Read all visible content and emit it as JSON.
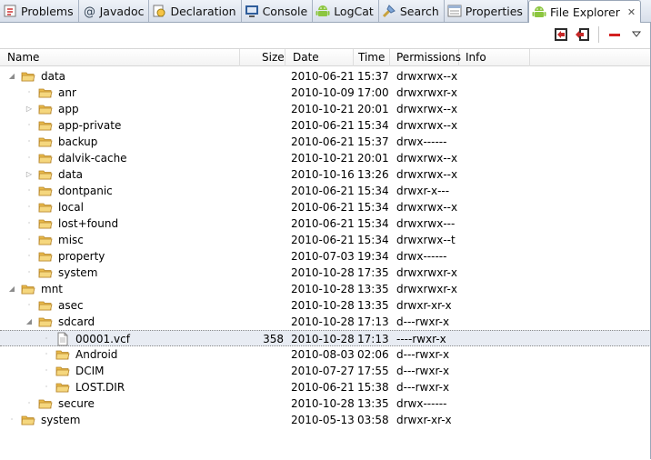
{
  "tabs": [
    {
      "label": "Problems",
      "icon": "problems-icon",
      "active": false
    },
    {
      "label": "Javadoc",
      "icon": "javadoc-icon",
      "active": false
    },
    {
      "label": "Declaration",
      "icon": "declaration-icon",
      "active": false
    },
    {
      "label": "Console",
      "icon": "console-icon",
      "active": false
    },
    {
      "label": "LogCat",
      "icon": "android-icon",
      "active": false
    },
    {
      "label": "Search",
      "icon": "search-icon",
      "active": false
    },
    {
      "label": "Properties",
      "icon": "properties-icon",
      "active": false
    },
    {
      "label": "File Explorer",
      "icon": "android-icon",
      "active": true
    }
  ],
  "toolbar": {
    "buttons": [
      "pull-file-icon",
      "push-file-icon",
      "delete-icon",
      "view-menu-icon"
    ]
  },
  "columns": [
    "Name",
    "Size",
    "Date",
    "Time",
    "Permissions",
    "Info"
  ],
  "rows": [
    {
      "name": "data",
      "size": "",
      "date": "2010-06-21",
      "time": "15:37",
      "perm": "drwxrwx--x",
      "depth": 0,
      "type": "folder",
      "expanded": true,
      "twisty": "open"
    },
    {
      "name": "anr",
      "size": "",
      "date": "2010-10-09",
      "time": "17:00",
      "perm": "drwxrwxr-x",
      "depth": 1,
      "type": "folder",
      "twisty": "none"
    },
    {
      "name": "app",
      "size": "",
      "date": "2010-10-21",
      "time": "20:01",
      "perm": "drwxrwx--x",
      "depth": 1,
      "type": "folder",
      "twisty": "closed"
    },
    {
      "name": "app-private",
      "size": "",
      "date": "2010-06-21",
      "time": "15:34",
      "perm": "drwxrwx--x",
      "depth": 1,
      "type": "folder",
      "twisty": "none"
    },
    {
      "name": "backup",
      "size": "",
      "date": "2010-06-21",
      "time": "15:37",
      "perm": "drwx------",
      "depth": 1,
      "type": "folder",
      "twisty": "none"
    },
    {
      "name": "dalvik-cache",
      "size": "",
      "date": "2010-10-21",
      "time": "20:01",
      "perm": "drwxrwx--x",
      "depth": 1,
      "type": "folder",
      "twisty": "none"
    },
    {
      "name": "data",
      "size": "",
      "date": "2010-10-16",
      "time": "13:26",
      "perm": "drwxrwx--x",
      "depth": 1,
      "type": "folder",
      "twisty": "closed"
    },
    {
      "name": "dontpanic",
      "size": "",
      "date": "2010-06-21",
      "time": "15:34",
      "perm": "drwxr-x---",
      "depth": 1,
      "type": "folder",
      "twisty": "none"
    },
    {
      "name": "local",
      "size": "",
      "date": "2010-06-21",
      "time": "15:34",
      "perm": "drwxrwx--x",
      "depth": 1,
      "type": "folder",
      "twisty": "none"
    },
    {
      "name": "lost+found",
      "size": "",
      "date": "2010-06-21",
      "time": "15:34",
      "perm": "drwxrwx---",
      "depth": 1,
      "type": "folder",
      "twisty": "none"
    },
    {
      "name": "misc",
      "size": "",
      "date": "2010-06-21",
      "time": "15:34",
      "perm": "drwxrwx--t",
      "depth": 1,
      "type": "folder",
      "twisty": "none"
    },
    {
      "name": "property",
      "size": "",
      "date": "2010-07-03",
      "time": "19:34",
      "perm": "drwx------",
      "depth": 1,
      "type": "folder",
      "twisty": "none"
    },
    {
      "name": "system",
      "size": "",
      "date": "2010-10-28",
      "time": "17:35",
      "perm": "drwxrwxr-x",
      "depth": 1,
      "type": "folder",
      "twisty": "none"
    },
    {
      "name": "mnt",
      "size": "",
      "date": "2010-10-28",
      "time": "13:35",
      "perm": "drwxrwxr-x",
      "depth": 0,
      "type": "folder",
      "twisty": "open"
    },
    {
      "name": "asec",
      "size": "",
      "date": "2010-10-28",
      "time": "13:35",
      "perm": "drwxr-xr-x",
      "depth": 1,
      "type": "folder",
      "twisty": "none"
    },
    {
      "name": "sdcard",
      "size": "",
      "date": "2010-10-28",
      "time": "17:13",
      "perm": "d---rwxr-x",
      "depth": 1,
      "type": "folder",
      "twisty": "open"
    },
    {
      "name": "00001.vcf",
      "size": "358",
      "date": "2010-10-28",
      "time": "17:13",
      "perm": "----rwxr-x",
      "depth": 2,
      "type": "file",
      "twisty": "none",
      "selected": true
    },
    {
      "name": "Android",
      "size": "",
      "date": "2010-08-03",
      "time": "02:06",
      "perm": "d---rwxr-x",
      "depth": 2,
      "type": "folder",
      "twisty": "none"
    },
    {
      "name": "DCIM",
      "size": "",
      "date": "2010-07-27",
      "time": "17:55",
      "perm": "d---rwxr-x",
      "depth": 2,
      "type": "folder",
      "twisty": "none"
    },
    {
      "name": "LOST.DIR",
      "size": "",
      "date": "2010-06-21",
      "time": "15:38",
      "perm": "d---rwxr-x",
      "depth": 2,
      "type": "folder",
      "twisty": "none"
    },
    {
      "name": "secure",
      "size": "",
      "date": "2010-10-28",
      "time": "13:35",
      "perm": "drwx------",
      "depth": 1,
      "type": "folder",
      "twisty": "none"
    },
    {
      "name": "system",
      "size": "",
      "date": "2010-05-13",
      "time": "03:58",
      "perm": "drwxr-xr-x",
      "depth": 0,
      "type": "folder",
      "twisty": "none"
    }
  ],
  "colors": {
    "folder": "#e9b949",
    "folder_dark": "#b8862a",
    "tab_active_bg": "#ffffff",
    "tabbar_bg": "#d8dfea",
    "selection": "#e8ecf3",
    "android_green": "#8cc63f"
  }
}
